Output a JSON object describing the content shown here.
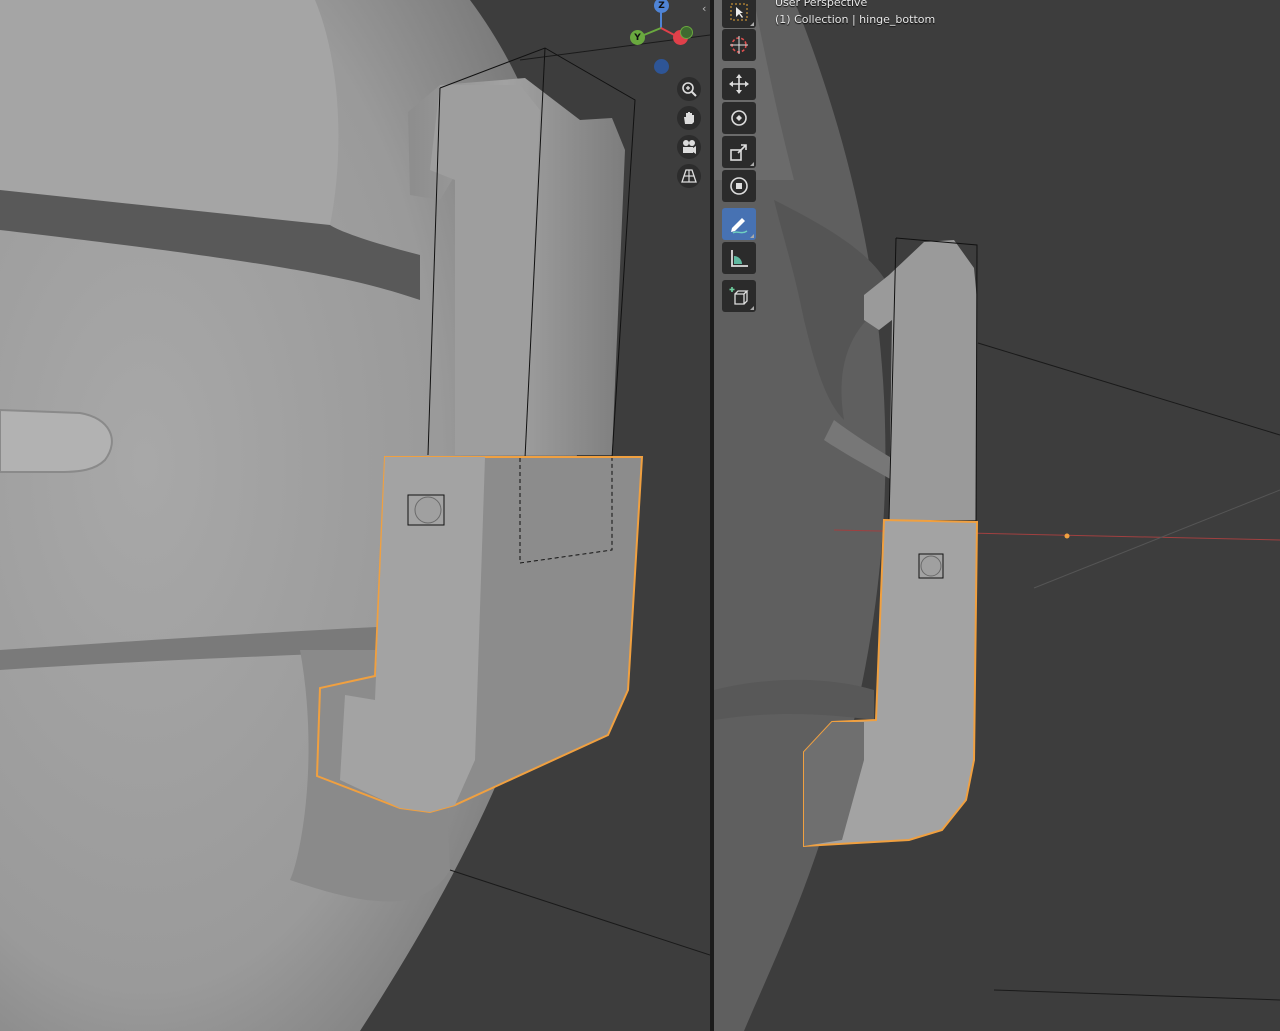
{
  "viewport_left": {
    "gizmo": {
      "z_label": "Z",
      "y_label": "Y",
      "x_color": "#e0404a",
      "y_color": "#6aa93f",
      "z_color": "#4f84d6"
    },
    "nav_controls": [
      "zoom-icon",
      "hand-pan-icon",
      "camera-icon",
      "grid-ortho-icon"
    ]
  },
  "viewport_right": {
    "header": {
      "perspective": "User Perspective",
      "collection": "(1) Collection | hinge_bottom"
    },
    "toolbar": [
      {
        "name": "select-box-tool",
        "icon": "cursor-select-icon",
        "active": false
      },
      {
        "name": "cursor-tool",
        "icon": "3d-cursor-icon",
        "active": false
      },
      {
        "name": "move-tool",
        "icon": "move-arrows-icon",
        "active": false
      },
      {
        "name": "rotate-tool",
        "icon": "rotate-icon",
        "active": false
      },
      {
        "name": "scale-tool",
        "icon": "scale-icon",
        "active": false
      },
      {
        "name": "transform-tool",
        "icon": "transform-icon",
        "active": false
      },
      {
        "name": "annotate-tool",
        "icon": "annotate-pencil-icon",
        "active": true
      },
      {
        "name": "measure-tool",
        "icon": "ruler-icon",
        "active": false
      },
      {
        "name": "add-cube-tool",
        "icon": "add-cube-icon",
        "active": false
      }
    ]
  },
  "colors": {
    "selection_outline": "#f0a040",
    "accent_active": "#4772b3",
    "background": "#3d3d3d",
    "mesh": "#9c9c9c"
  }
}
